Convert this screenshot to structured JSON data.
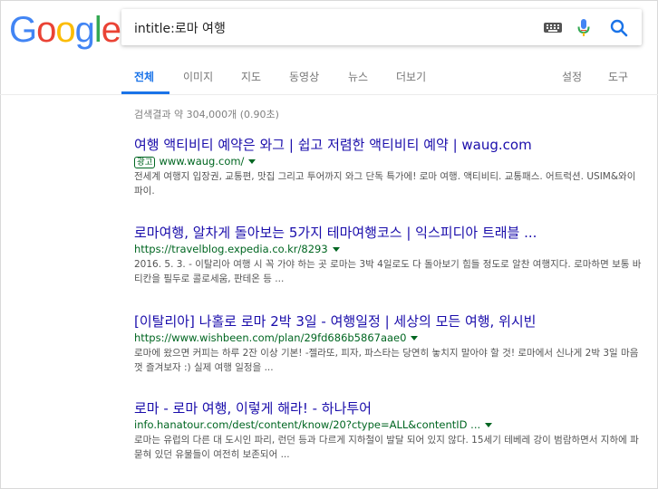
{
  "search": {
    "query": "intitle:로마 여행"
  },
  "logo": {
    "letters": [
      "G",
      "o",
      "o",
      "g",
      "l",
      "e"
    ],
    "colors": [
      "#4285F4",
      "#EA4335",
      "#FBBC05",
      "#4285F4",
      "#34A853",
      "#EA4335"
    ]
  },
  "nav": {
    "tabs": [
      "전체",
      "이미지",
      "지도",
      "동영상",
      "뉴스",
      "더보기"
    ],
    "right": [
      "설정",
      "도구"
    ],
    "active": "전체"
  },
  "stats": "검색결과 약 304,000개 (0.90초)",
  "results": [
    {
      "title": "여행 액티비티 예약은 와그 | 쉽고 저렴한 액티비티 예약 | waug.com",
      "ad_label": "광고",
      "url": "www.waug.com/",
      "snippet": "전세계 여행지 입장권, 교통편, 맛집 그리고 투어까지 와그 단독 특가에! 로마 여행. 액티비티. 교통패스. 어트럭션. USIM&와이파이."
    },
    {
      "title": "로마여행, 알차게 돌아보는 5가지 테마여행코스 | 익스피디아 트래블 ...",
      "url": "https://travelblog.expedia.co.kr/8293",
      "snippet": "2016. 5. 3. - 이탈리아 여행 시 꼭 가야 하는 곳 로마는 3박 4일로도 다 돌아보기 힘들 정도로 알찬 여행지다. 로마하면 보통 바티칸을 필두로 콜로세움, 판테온 등 ..."
    },
    {
      "title": "[이탈리아] 나홀로 로마 2박 3일 - 여행일정 | 세상의 모든 여행, 위시빈",
      "url": "https://www.wishbeen.com/plan/29fd686b5867aae0",
      "snippet": "로마에 왔으면 커피는 하루 2잔 이상 기본! -젤라또, 피자, 파스타는 당연히 놓치지 말아야 할 것! 로마에서 신나게 2박 3일 마음껏 즐겨보자 :) 실제 여행 일정을 ..."
    },
    {
      "title": "로마 - 로마 여행, 이렇게 해라! - 하나투어",
      "url": "info.hanatour.com/dest/content/know/20?ctype=ALL&contentID ...",
      "snippet": "로마는 유럽의 다른 대 도시인 파리, 런던 등과 다르게 지하철이 발달 되어 있지 않다. 15세기 테베레 강이 범람하면서 지하에 파묻혀 있던 유물들이 여전히 보존되어 ..."
    }
  ]
}
